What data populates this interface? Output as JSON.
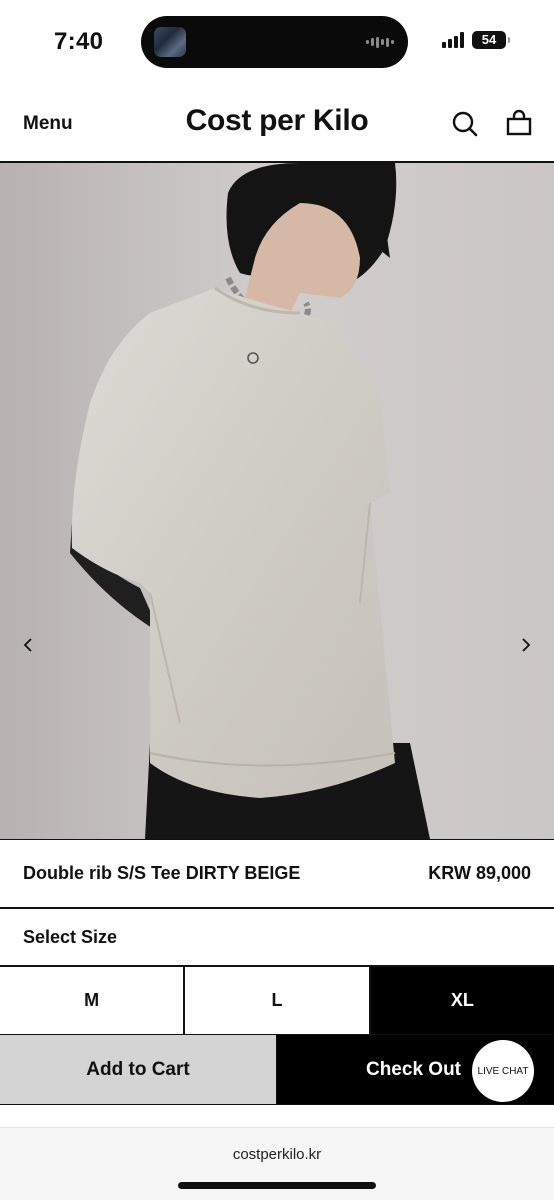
{
  "status_bar": {
    "time": "7:40",
    "battery": "54",
    "icons": [
      "signal-icon",
      "battery-icon",
      "audio-wave-icon"
    ]
  },
  "header": {
    "menu_label": "Menu",
    "brand": "Cost per Kilo",
    "icons": [
      "search-icon",
      "shopping-bag-icon"
    ]
  },
  "carousel": {
    "icons": [
      "chevron-left-icon",
      "chevron-right-icon"
    ]
  },
  "product": {
    "name": "Double rib S/S Tee DIRTY BEIGE",
    "price": "KRW 89,000"
  },
  "size_selector": {
    "label": "Select Size",
    "options": [
      "M",
      "L",
      "XL"
    ],
    "selected": "XL"
  },
  "actions": {
    "add_to_cart": "Add to Cart",
    "check_out": "Check Out",
    "live_chat": "LIVE CHAT"
  },
  "browser": {
    "url": "costperkilo.kr"
  },
  "colors": {
    "primary": "#000000",
    "secondary_button": "#d4d4d4",
    "background": "#ffffff"
  }
}
